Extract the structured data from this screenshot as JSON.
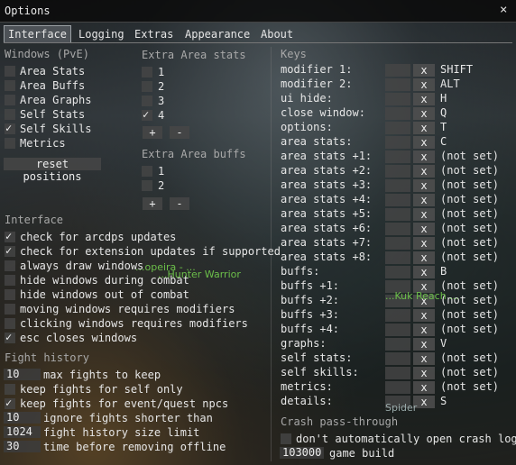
{
  "window": {
    "title": "Options",
    "close": "×"
  },
  "tabs": [
    "Interface",
    "Logging",
    "Extras",
    "Appearance",
    "About"
  ],
  "windows": {
    "header": "Windows (PvE)",
    "items": [
      {
        "label": "Area Stats",
        "checked": false
      },
      {
        "label": "Area Buffs",
        "checked": false
      },
      {
        "label": "Area Graphs",
        "checked": false
      },
      {
        "label": "Self Stats",
        "checked": false
      },
      {
        "label": "Self Skills",
        "checked": true
      },
      {
        "label": "Metrics",
        "checked": false
      }
    ],
    "reset": "reset positions"
  },
  "extra_stats": {
    "header": "Extra Area stats",
    "items": [
      {
        "label": "1",
        "checked": false
      },
      {
        "label": "2",
        "checked": false
      },
      {
        "label": "3",
        "checked": false
      },
      {
        "label": "4",
        "checked": true
      }
    ],
    "plus": "+",
    "minus": "-"
  },
  "extra_buffs": {
    "header": "Extra Area buffs",
    "items": [
      {
        "label": "1",
        "checked": false
      },
      {
        "label": "2",
        "checked": false
      }
    ],
    "plus": "+",
    "minus": "-"
  },
  "interface": {
    "header": "Interface",
    "items": [
      {
        "label": "check for arcdps updates",
        "checked": true
      },
      {
        "label": "check for extension updates if supported",
        "checked": true
      },
      {
        "label": "always draw windows",
        "checked": false
      },
      {
        "label": "hide windows during combat",
        "checked": false
      },
      {
        "label": "hide windows out of combat",
        "checked": false
      },
      {
        "label": "moving windows requires modifiers",
        "checked": false
      },
      {
        "label": "clicking windows requires modifiers",
        "checked": false
      },
      {
        "label": "esc closes windows",
        "checked": true
      }
    ]
  },
  "fight_history": {
    "header": "Fight history",
    "max_fights": {
      "value": "10",
      "label": "max fights to keep"
    },
    "keep_self": {
      "label": "keep fights for self only",
      "checked": false
    },
    "keep_npcs": {
      "label": "keep fights for event/quest npcs",
      "checked": true
    },
    "ignore_shorter": {
      "value": "10",
      "label": "ignore fights shorter than"
    },
    "size_limit": {
      "value": "1024",
      "label": "fight history size limit"
    },
    "remove_offline": {
      "value": "30",
      "label": "time before removing offline"
    }
  },
  "keys": {
    "header": "Keys",
    "clear": "x",
    "rows": [
      {
        "label": "modifier 1:",
        "value": "SHIFT"
      },
      {
        "label": "modifier 2:",
        "value": "ALT"
      },
      {
        "label": "ui hide:",
        "value": "H"
      },
      {
        "label": "close window:",
        "value": "Q"
      },
      {
        "label": "options:",
        "value": "T"
      },
      {
        "label": "area stats:",
        "value": "C"
      },
      {
        "label": "area stats +1:",
        "value": "(not set)"
      },
      {
        "label": "area stats +2:",
        "value": "(not set)"
      },
      {
        "label": "area stats +3:",
        "value": "(not set)"
      },
      {
        "label": "area stats +4:",
        "value": "(not set)"
      },
      {
        "label": "area stats +5:",
        "value": "(not set)"
      },
      {
        "label": "area stats +6:",
        "value": "(not set)"
      },
      {
        "label": "area stats +7:",
        "value": "(not set)"
      },
      {
        "label": "area stats +8:",
        "value": "(not set)"
      },
      {
        "label": "buffs:",
        "value": "B"
      },
      {
        "label": "buffs +1:",
        "value": "(not set)"
      },
      {
        "label": "buffs +2:",
        "value": "(not set)"
      },
      {
        "label": "buffs +3:",
        "value": "(not set)"
      },
      {
        "label": "buffs +4:",
        "value": "(not set)"
      },
      {
        "label": "graphs:",
        "value": "V"
      },
      {
        "label": "self stats:",
        "value": "(not set)"
      },
      {
        "label": "self skills:",
        "value": "(not set)"
      },
      {
        "label": "metrics:",
        "value": "(not set)"
      },
      {
        "label": "details:",
        "value": "S"
      }
    ]
  },
  "crash": {
    "header": "Crash pass-through",
    "no_open": {
      "label": "don't automatically open crash log",
      "checked": false
    },
    "build": {
      "value": "103000",
      "label": "game build"
    }
  },
  "background_text": {
    "npc1": "...opeira - ...",
    "npc2": "...Hunter Warrior",
    "npc3": "...Kuk Reach ...",
    "npc4": "Spider"
  }
}
